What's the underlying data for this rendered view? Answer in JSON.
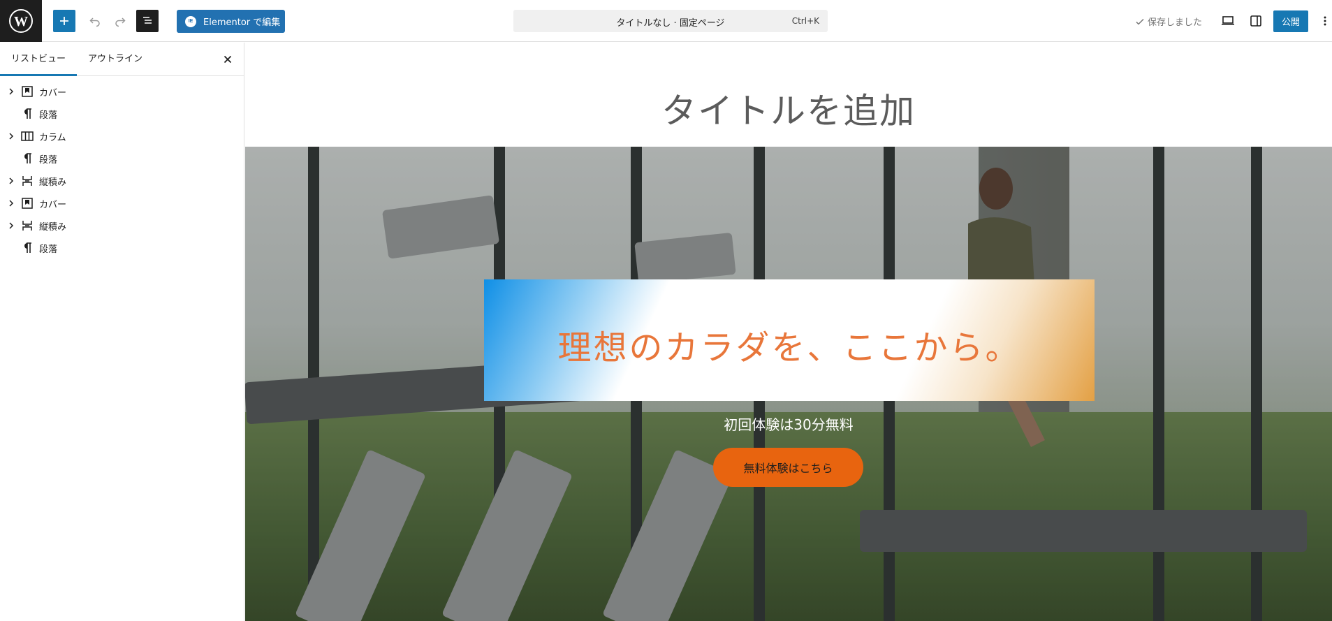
{
  "toolbar": {
    "elementor_label": "Elementor で編集",
    "elementor_badge": "IE",
    "doc_title": "タイトルなし · 固定ページ",
    "shortcut": "Ctrl+K",
    "saved_label": "保存しました",
    "publish_label": "公開"
  },
  "sidebar": {
    "tab_list": "リストビュー",
    "tab_outline": "アウトライン",
    "items": [
      {
        "label": "カバー",
        "icon": "cover-icon",
        "expandable": true
      },
      {
        "label": "段落",
        "icon": "paragraph-icon",
        "expandable": false
      },
      {
        "label": "カラム",
        "icon": "columns-icon",
        "expandable": true
      },
      {
        "label": "段落",
        "icon": "paragraph-icon",
        "expandable": false
      },
      {
        "label": "縦積み",
        "icon": "stack-icon",
        "expandable": true
      },
      {
        "label": "カバー",
        "icon": "cover-icon",
        "expandable": true
      },
      {
        "label": "縦積み",
        "icon": "stack-icon",
        "expandable": true
      },
      {
        "label": "段落",
        "icon": "paragraph-icon",
        "expandable": false
      }
    ]
  },
  "canvas": {
    "page_title_placeholder": "タイトルを追加",
    "hero_heading": "理想のカラダを、ここから。",
    "sub_text": "初回体験は30分無料",
    "cta_label": "無料体験はこちら"
  },
  "colors": {
    "accent": "#1778b3",
    "cta": "#e8640f",
    "heading": "#e8763a"
  }
}
